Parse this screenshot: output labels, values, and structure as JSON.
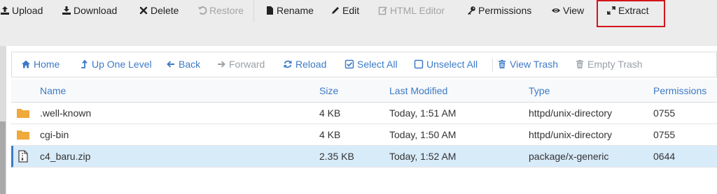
{
  "toolbar": {
    "upload": "Upload",
    "download": "Download",
    "delete": "Delete",
    "restore": "Restore",
    "rename": "Rename",
    "edit": "Edit",
    "html_editor": "HTML Editor",
    "permissions": "Permissions",
    "view": "View",
    "extract": "Extract"
  },
  "navbar": {
    "home": "Home",
    "up_one_level": "Up One Level",
    "back": "Back",
    "forward": "Forward",
    "reload": "Reload",
    "select_all": "Select All",
    "unselect_all": "Unselect All",
    "view_trash": "View Trash",
    "empty_trash": "Empty Trash"
  },
  "table": {
    "columns": [
      "Name",
      "Size",
      "Last Modified",
      "Type",
      "Permissions"
    ],
    "rows": [
      {
        "name": ".well-known",
        "size": "4 KB",
        "modified": "Today, 1:51 AM",
        "type": "httpd/unix-directory",
        "perms": "0755",
        "icon": "folder-icon"
      },
      {
        "name": "cgi-bin",
        "size": "4 KB",
        "modified": "Today, 1:50 AM",
        "type": "httpd/unix-directory",
        "perms": "0755",
        "icon": "folder-icon"
      },
      {
        "name": "c4_baru.zip",
        "size": "2.35 KB",
        "modified": "Today, 1:52 AM",
        "type": "package/x-generic",
        "perms": "0644",
        "icon": "zip-file-icon"
      }
    ]
  },
  "colors": {
    "link": "#3c7ac6",
    "highlight": "#d4141d",
    "selected_row": "#d8ebf9",
    "folder": "#f0a93b"
  }
}
